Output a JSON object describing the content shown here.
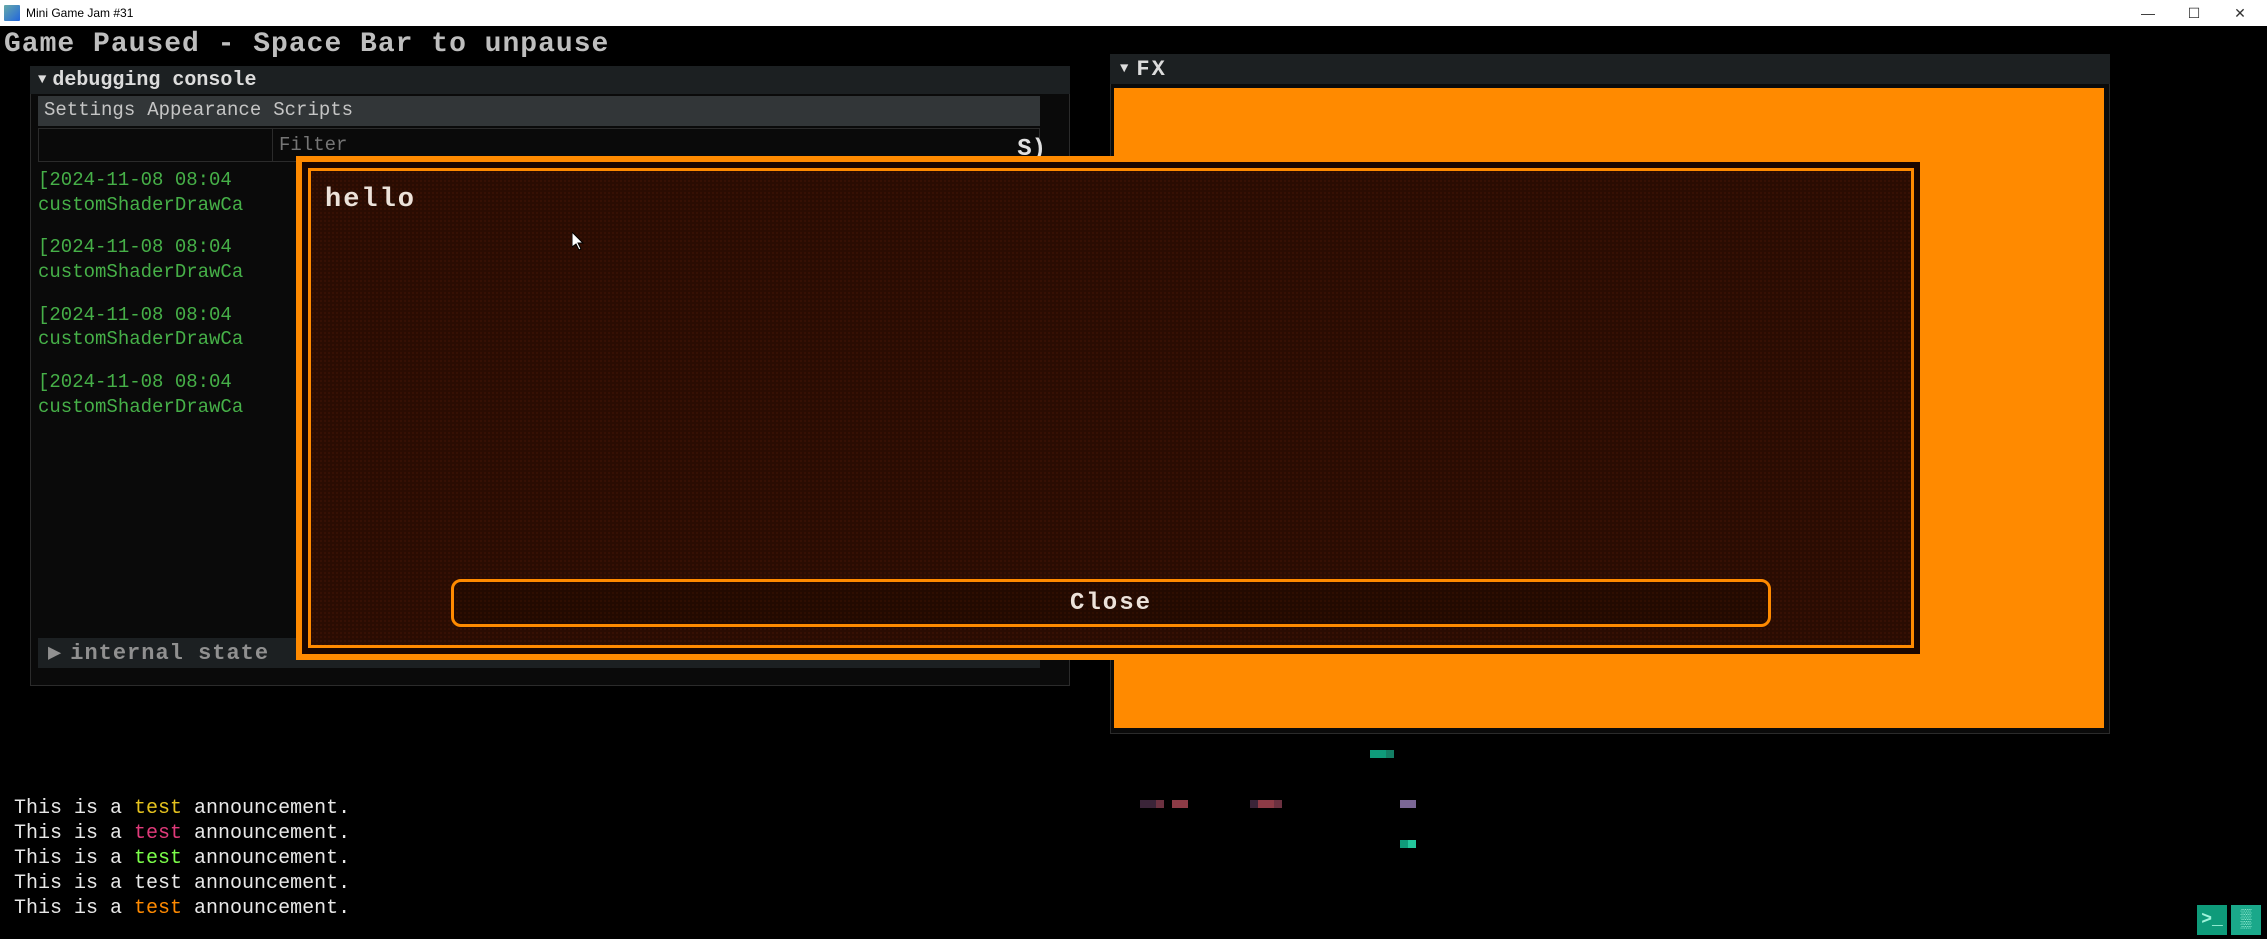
{
  "window": {
    "title": "Mini Game Jam #31"
  },
  "pause_text": "Game Paused - Space Bar to unpause",
  "debug": {
    "header": "debugging console",
    "tabs": [
      "Settings",
      "Appearance",
      "Scripts"
    ],
    "filter_placeholder": "Filter",
    "s_indicator": "S)",
    "internal_label": "internal state",
    "log_entries": [
      {
        "ts": "[2024-11-08 08:04",
        "body": "customShaderDrawCa"
      },
      {
        "ts": "[2024-11-08 08:04",
        "body": "customShaderDrawCa"
      },
      {
        "ts": "[2024-11-08 08:04",
        "body": "customShaderDrawCa"
      },
      {
        "ts": "[2024-11-08 08:04",
        "body": "customShaderDrawCa"
      }
    ]
  },
  "fx": {
    "header": "FX"
  },
  "dialog": {
    "text": "hello",
    "close_label": "Close"
  },
  "announcements": {
    "prefix": "This is a ",
    "word": "test",
    "suffix": " announcement.",
    "colors": [
      "c1",
      "c2",
      "c3",
      "w",
      "c4"
    ]
  },
  "tray": {
    "btn1_glyph": ">_",
    "btn2_glyph": "▒"
  }
}
